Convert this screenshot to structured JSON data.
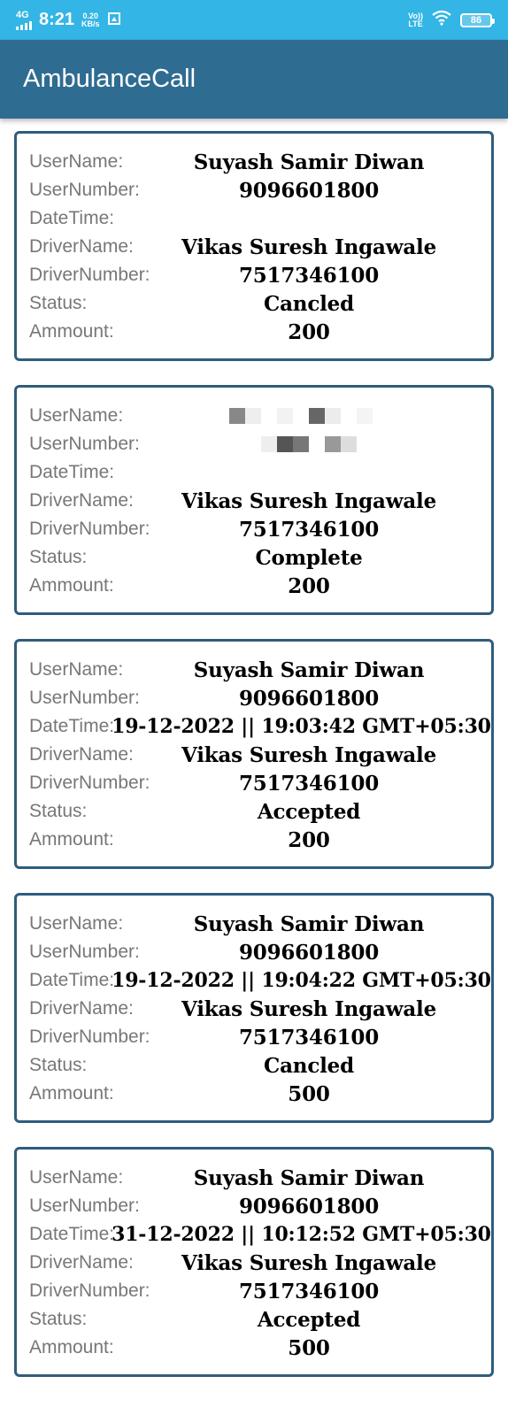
{
  "status_bar": {
    "network": "4G",
    "time": "8:21",
    "speed_value": "0.20",
    "speed_unit": "KB/s",
    "volte_top": "Vo))",
    "volte_bottom": "LTE",
    "battery": "86"
  },
  "app_title": "AmbulanceCall",
  "labels": {
    "username": "UserName:",
    "usernumber": "UserNumber:",
    "datetime": "DateTime:",
    "drivername": "DriverName:",
    "drivernumber": "DriverNumber:",
    "status": "Status:",
    "amount": "Ammount:"
  },
  "bookings": [
    {
      "user_name": "Suyash Samir Diwan",
      "user_number": "9096601800",
      "date_time": "",
      "driver_name": "Vikas Suresh Ingawale",
      "driver_number": "7517346100",
      "status": "Cancled",
      "amount": "200"
    },
    {
      "user_name": "",
      "user_number": "",
      "date_time": "",
      "driver_name": "Vikas Suresh Ingawale",
      "driver_number": "7517346100",
      "status": "Complete",
      "amount": "200"
    },
    {
      "user_name": "Suyash Samir Diwan",
      "user_number": "9096601800",
      "date_time": "19-12-2022 || 19:03:42 GMT+05:30",
      "driver_name": "Vikas Suresh Ingawale",
      "driver_number": "7517346100",
      "status": "Accepted",
      "amount": "200"
    },
    {
      "user_name": "Suyash Samir Diwan",
      "user_number": "9096601800",
      "date_time": "19-12-2022 || 19:04:22 GMT+05:30",
      "driver_name": "Vikas Suresh Ingawale",
      "driver_number": "7517346100",
      "status": "Cancled",
      "amount": "500"
    },
    {
      "user_name": "Suyash Samir Diwan",
      "user_number": "9096601800",
      "date_time": "31-12-2022 || 10:12:52 GMT+05:30",
      "driver_name": "Vikas Suresh Ingawale",
      "driver_number": "7517346100",
      "status": "Accepted",
      "amount": "500"
    }
  ]
}
